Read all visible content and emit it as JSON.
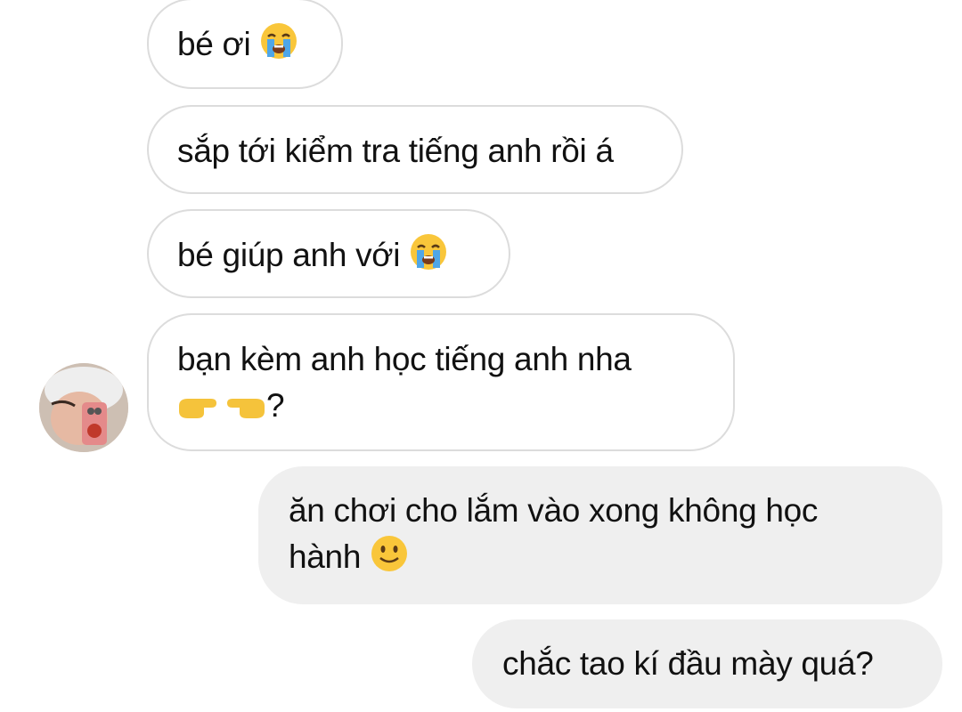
{
  "messages": {
    "received": [
      {
        "text": "bé ơi",
        "emoji": "loudly-crying-face-icon"
      },
      {
        "text": "sắp tới kiểm tra tiếng anh rồi á"
      },
      {
        "text": "bé giúp anh với",
        "emoji": "loudly-crying-face-icon"
      },
      {
        "line1": "bạn kèm anh học tiếng anh nha",
        "line2": "?",
        "emoji": "pointing-fingers-icon"
      }
    ],
    "sent": [
      {
        "line1": "ăn chơi cho lắm vào xong không học",
        "line2": "hành",
        "emoji": "slightly-smiling-face-icon"
      },
      {
        "text": "chắc tao kí đầu mày quá?"
      }
    ]
  },
  "colors": {
    "received_bubble_border": "#dcdcdc",
    "sent_bubble_bg": "#efefef",
    "text": "#111111",
    "emoji_yellow": "#f9c63a"
  }
}
